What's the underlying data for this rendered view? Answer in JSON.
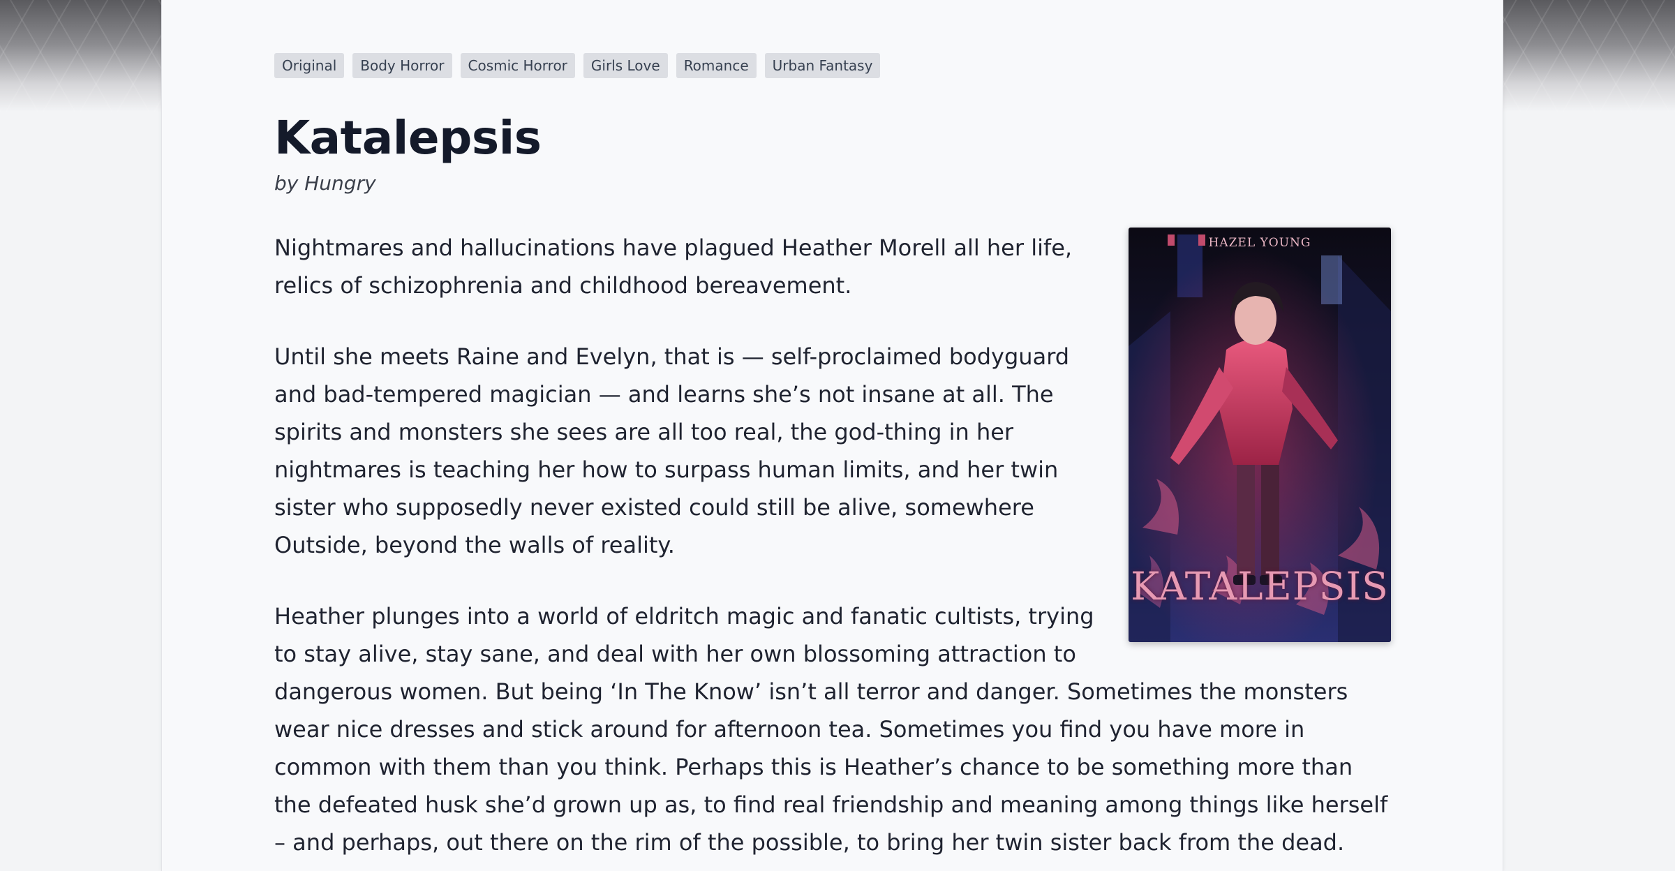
{
  "tags": [
    "Original",
    "Body Horror",
    "Cosmic Horror",
    "Girls Love",
    "Romance",
    "Urban Fantasy"
  ],
  "book": {
    "title": "Katalepsis",
    "byline": "by Hungry"
  },
  "cover": {
    "author_text": "HAZEL YOUNG",
    "title_text": "KATALEPSIS"
  },
  "description": [
    "Nightmares and hallucinations have plagued Heather Morell all her life, relics of schizophrenia and childhood bereavement.",
    "Until she meets Raine and Evelyn, that is — self-proclaimed bodyguard and bad-tempered magician — and learns she’s not insane at all. The spirits and monsters she sees are all too real, the god-thing in her nightmares is teaching her how to surpass human limits, and her twin sister who supposedly never existed could still be alive, somewhere Outside, beyond the walls of reality.",
    "Heather plunges into a world of eldritch magic and fanatic cultists, trying to stay alive, stay sane, and deal with her own blossoming attraction to dangerous women. But being ‘In The Know’ isn’t all terror and danger. Sometimes the monsters wear nice dresses and stick around for afternoon tea. Sometimes you find you have more in common with them than you think. Perhaps this is Heather’s chance to be something more than the defeated husk she’d grown up as, to find real friendship and meaning among things like herself – and perhaps, out there on the rim of the possible, to bring her twin sister back from the dead."
  ]
}
